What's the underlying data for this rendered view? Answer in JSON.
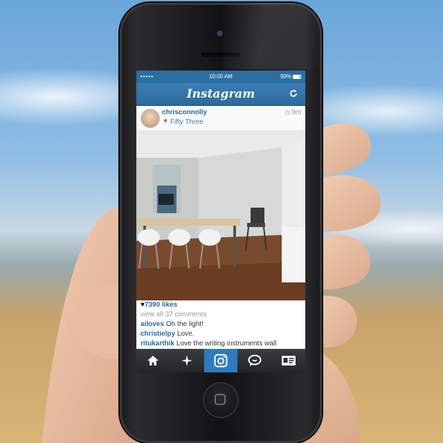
{
  "statusbar": {
    "time": "10:00 AM",
    "battery": "99%",
    "carrier": "•••••"
  },
  "navbar": {
    "title": "Instagram",
    "refresh_icon": "refresh-icon"
  },
  "post": {
    "username": "chrisconnolly",
    "location": "Fifty Three",
    "time_ago": "9m",
    "likes": "7390 likes",
    "view_all": "view all 37 comments",
    "comments": [
      {
        "user": "ailoves",
        "text": "Oh the light!"
      },
      {
        "user": "christielpy",
        "text": "Love."
      },
      {
        "user": "ritukarthik",
        "text": "Love the writing instruments wall"
      }
    ]
  },
  "tabs": [
    {
      "name": "tab-home",
      "icon": "home-icon",
      "active": false
    },
    {
      "name": "tab-explore",
      "icon": "compass-icon",
      "active": false
    },
    {
      "name": "tab-camera",
      "icon": "camera-icon",
      "active": true
    },
    {
      "name": "tab-news",
      "icon": "speech-bubble-icon",
      "active": false
    },
    {
      "name": "tab-profile",
      "icon": "profile-card-icon",
      "active": false
    }
  ],
  "colors": {
    "accent": "#2e7bbf",
    "navbar": "#3b7fb5",
    "link": "#2a6a9c"
  }
}
